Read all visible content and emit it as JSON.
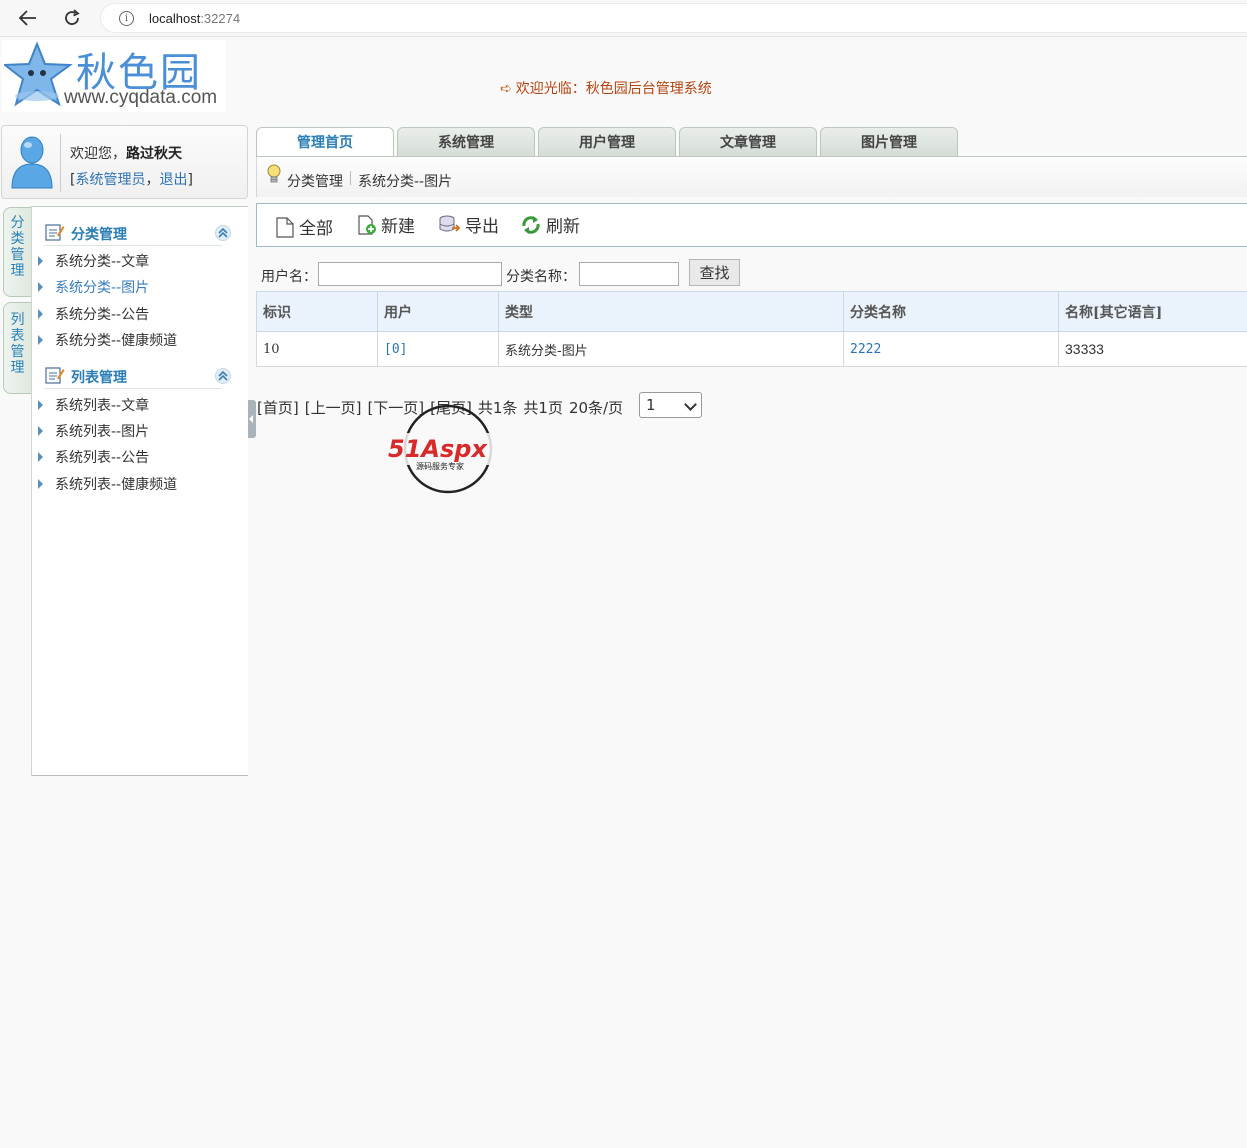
{
  "browser": {
    "url_host": "localhost",
    "url_port": ":32274"
  },
  "header": {
    "logo_cn": "秋色园",
    "logo_en": "www.cyqdata.com",
    "welcome": "欢迎光临：秋色园后台管理系统"
  },
  "user": {
    "greeting_prefix": "欢迎您，",
    "name": "路过秋天",
    "bracket_open": "[",
    "role_link": "系统管理员",
    "comma": "，",
    "logout_link": "退出",
    "bracket_close": "]"
  },
  "vertical_tabs": [
    {
      "chars": [
        "分",
        "类",
        "管",
        "理"
      ]
    },
    {
      "chars": [
        "列",
        "表",
        "管",
        "理"
      ]
    }
  ],
  "sidebar": {
    "sections": [
      {
        "title": "分类管理",
        "items": [
          "系统分类--文章",
          "系统分类--图片",
          "系统分类--公告",
          "系统分类--健康频道"
        ]
      },
      {
        "title": "列表管理",
        "items": [
          "系统列表--文章",
          "系统列表--图片",
          "系统列表--公告",
          "系统列表--健康频道"
        ]
      }
    ]
  },
  "tabs": [
    "管理首页",
    "系统管理",
    "用户管理",
    "文章管理",
    "图片管理"
  ],
  "breadcrumb": {
    "first": "分类管理",
    "second": "系统分类--图片"
  },
  "toolbar": {
    "all": "全部",
    "new": "新建",
    "export": "导出",
    "refresh": "刷新"
  },
  "search": {
    "username_label": "用户名：",
    "username_value": "",
    "category_label": "分类名称：",
    "category_value": "",
    "button": "查找"
  },
  "grid": {
    "headers": [
      "标识",
      "用户",
      "类型",
      "分类名称",
      "名称[其它语言]"
    ],
    "rows": [
      [
        "10",
        "[0]",
        "系统分类-图片",
        "2222",
        "33333"
      ]
    ]
  },
  "pager": {
    "first": "[首页]",
    "prev": "[上一页]",
    "next": "[下一页]",
    "last": "[尾页]",
    "total": "共1条",
    "pages": "共1页",
    "per_page": "20条/页",
    "current": "1"
  },
  "watermark": {
    "text": "51Aspx",
    "sub": "源码服务专家"
  },
  "colors": {
    "accent_blue": "#2a7eb5",
    "welcome_orange": "#b4440f",
    "header_bg": "#eaf2fb"
  }
}
